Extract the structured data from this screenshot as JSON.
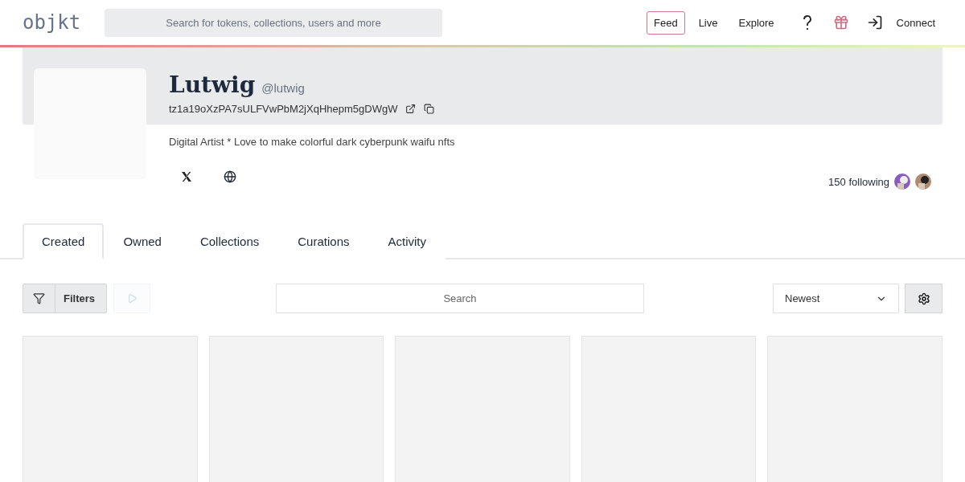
{
  "header": {
    "logo": "objkt",
    "search": {
      "placeholder": "Search for tokens, collections, users and more"
    },
    "nav": [
      {
        "label": "Feed",
        "selected": true
      },
      {
        "label": "Live",
        "selected": false
      },
      {
        "label": "Explore",
        "selected": false
      }
    ],
    "connect": "Connect"
  },
  "profile": {
    "name": "Lutwig",
    "handle": "@lutwig",
    "address": "tz1a19oXzPA7sULFVwPbM2jXqHhepm5gDWgW",
    "bio": "Digital Artist * Love to make colorful dark cyberpunk waifu nfts",
    "following": "150 following"
  },
  "tabs": [
    {
      "label": "Created",
      "selected": true
    },
    {
      "label": "Owned",
      "selected": false
    },
    {
      "label": "Collections",
      "selected": false
    },
    {
      "label": "Curations",
      "selected": false
    },
    {
      "label": "Activity",
      "selected": false
    }
  ],
  "toolbar": {
    "filters": "Filters",
    "play_disabled": true,
    "search": {
      "placeholder": "Search"
    },
    "sort": "Newest"
  },
  "cards": [
    {
      "kind": "placeholder"
    },
    {
      "kind": "placeholder"
    },
    {
      "kind": "placeholder"
    },
    {
      "kind": "placeholder"
    },
    {
      "kind": "placeholder"
    }
  ]
}
